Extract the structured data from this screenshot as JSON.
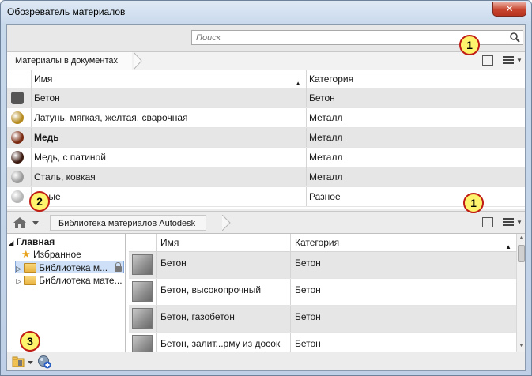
{
  "window": {
    "title": "Обозреватель материалов",
    "close_glyph": "✕"
  },
  "search": {
    "placeholder": "Поиск",
    "value": ""
  },
  "document_materials": {
    "breadcrumb": "Материалы в документах",
    "columns": {
      "name": "Имя",
      "category": "Категория"
    },
    "rows": [
      {
        "name": "Бетон",
        "category": "Бетон",
        "swatch": "#555555",
        "bold": false
      },
      {
        "name": "Латунь, мягкая, желтая, сварочная",
        "category": "Металл",
        "swatch": "#b58a1e",
        "bold": false
      },
      {
        "name": "Медь",
        "category": "Металл",
        "swatch": "#7a2a12",
        "bold": true
      },
      {
        "name": "Медь, с патиной",
        "category": "Металл",
        "swatch": "#3c1a10",
        "bold": false
      },
      {
        "name": "Сталь, ковкая",
        "category": "Металл",
        "swatch": "#9a9a9a",
        "bold": false
      },
      {
        "name": "…вые",
        "category": "Разное",
        "swatch": "#b5b5b5",
        "bold": false
      }
    ]
  },
  "library": {
    "breadcrumb": "Библиотека материалов Autodesk",
    "tree": {
      "root": "Главная",
      "favorites": "Избранное",
      "items": [
        "Библиотека м...",
        "Библиотека мате..."
      ]
    },
    "columns": {
      "name": "Имя",
      "category": "Категория"
    },
    "rows": [
      {
        "name": "Бетон",
        "category": "Бетон"
      },
      {
        "name": "Бетон, высокопрочный",
        "category": "Бетон"
      },
      {
        "name": "Бетон, газобетон",
        "category": "Бетон"
      },
      {
        "name": "Бетон, залит...рму из досок",
        "category": "Бетон"
      }
    ]
  },
  "callouts": [
    "1",
    "1",
    "2",
    "3"
  ],
  "colors": {
    "callout_fill": "#fdf36c",
    "callout_border": "#c01b14",
    "selection": "#cde0f7"
  }
}
